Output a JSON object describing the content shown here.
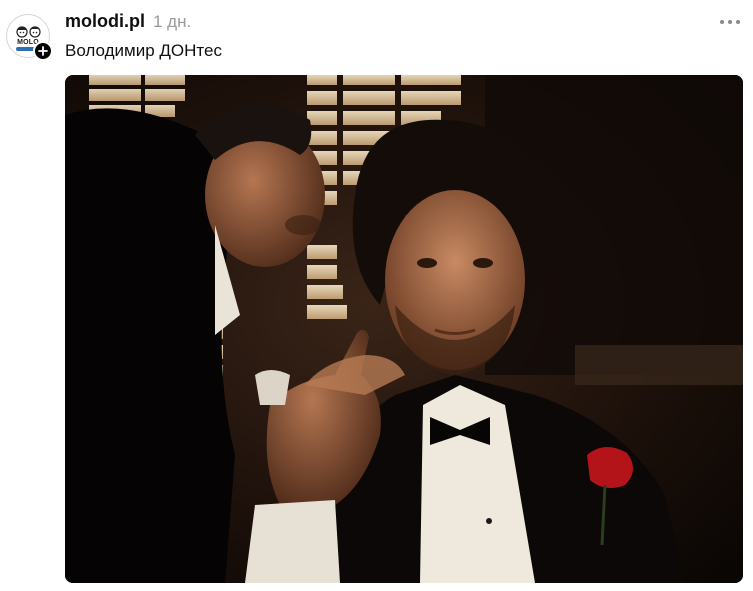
{
  "post": {
    "username": "molodi.pl",
    "timestamp": "1 дн.",
    "caption": "Володимир ДОНтес",
    "avatar_label": "MOLO",
    "icons": {
      "follow": "plus-icon",
      "more": "more-horizontal-icon",
      "avatar": "avatar-logo-icon"
    },
    "colors": {
      "text": "#101010",
      "muted": "#9a9a9a",
      "badge": "#000000"
    }
  }
}
